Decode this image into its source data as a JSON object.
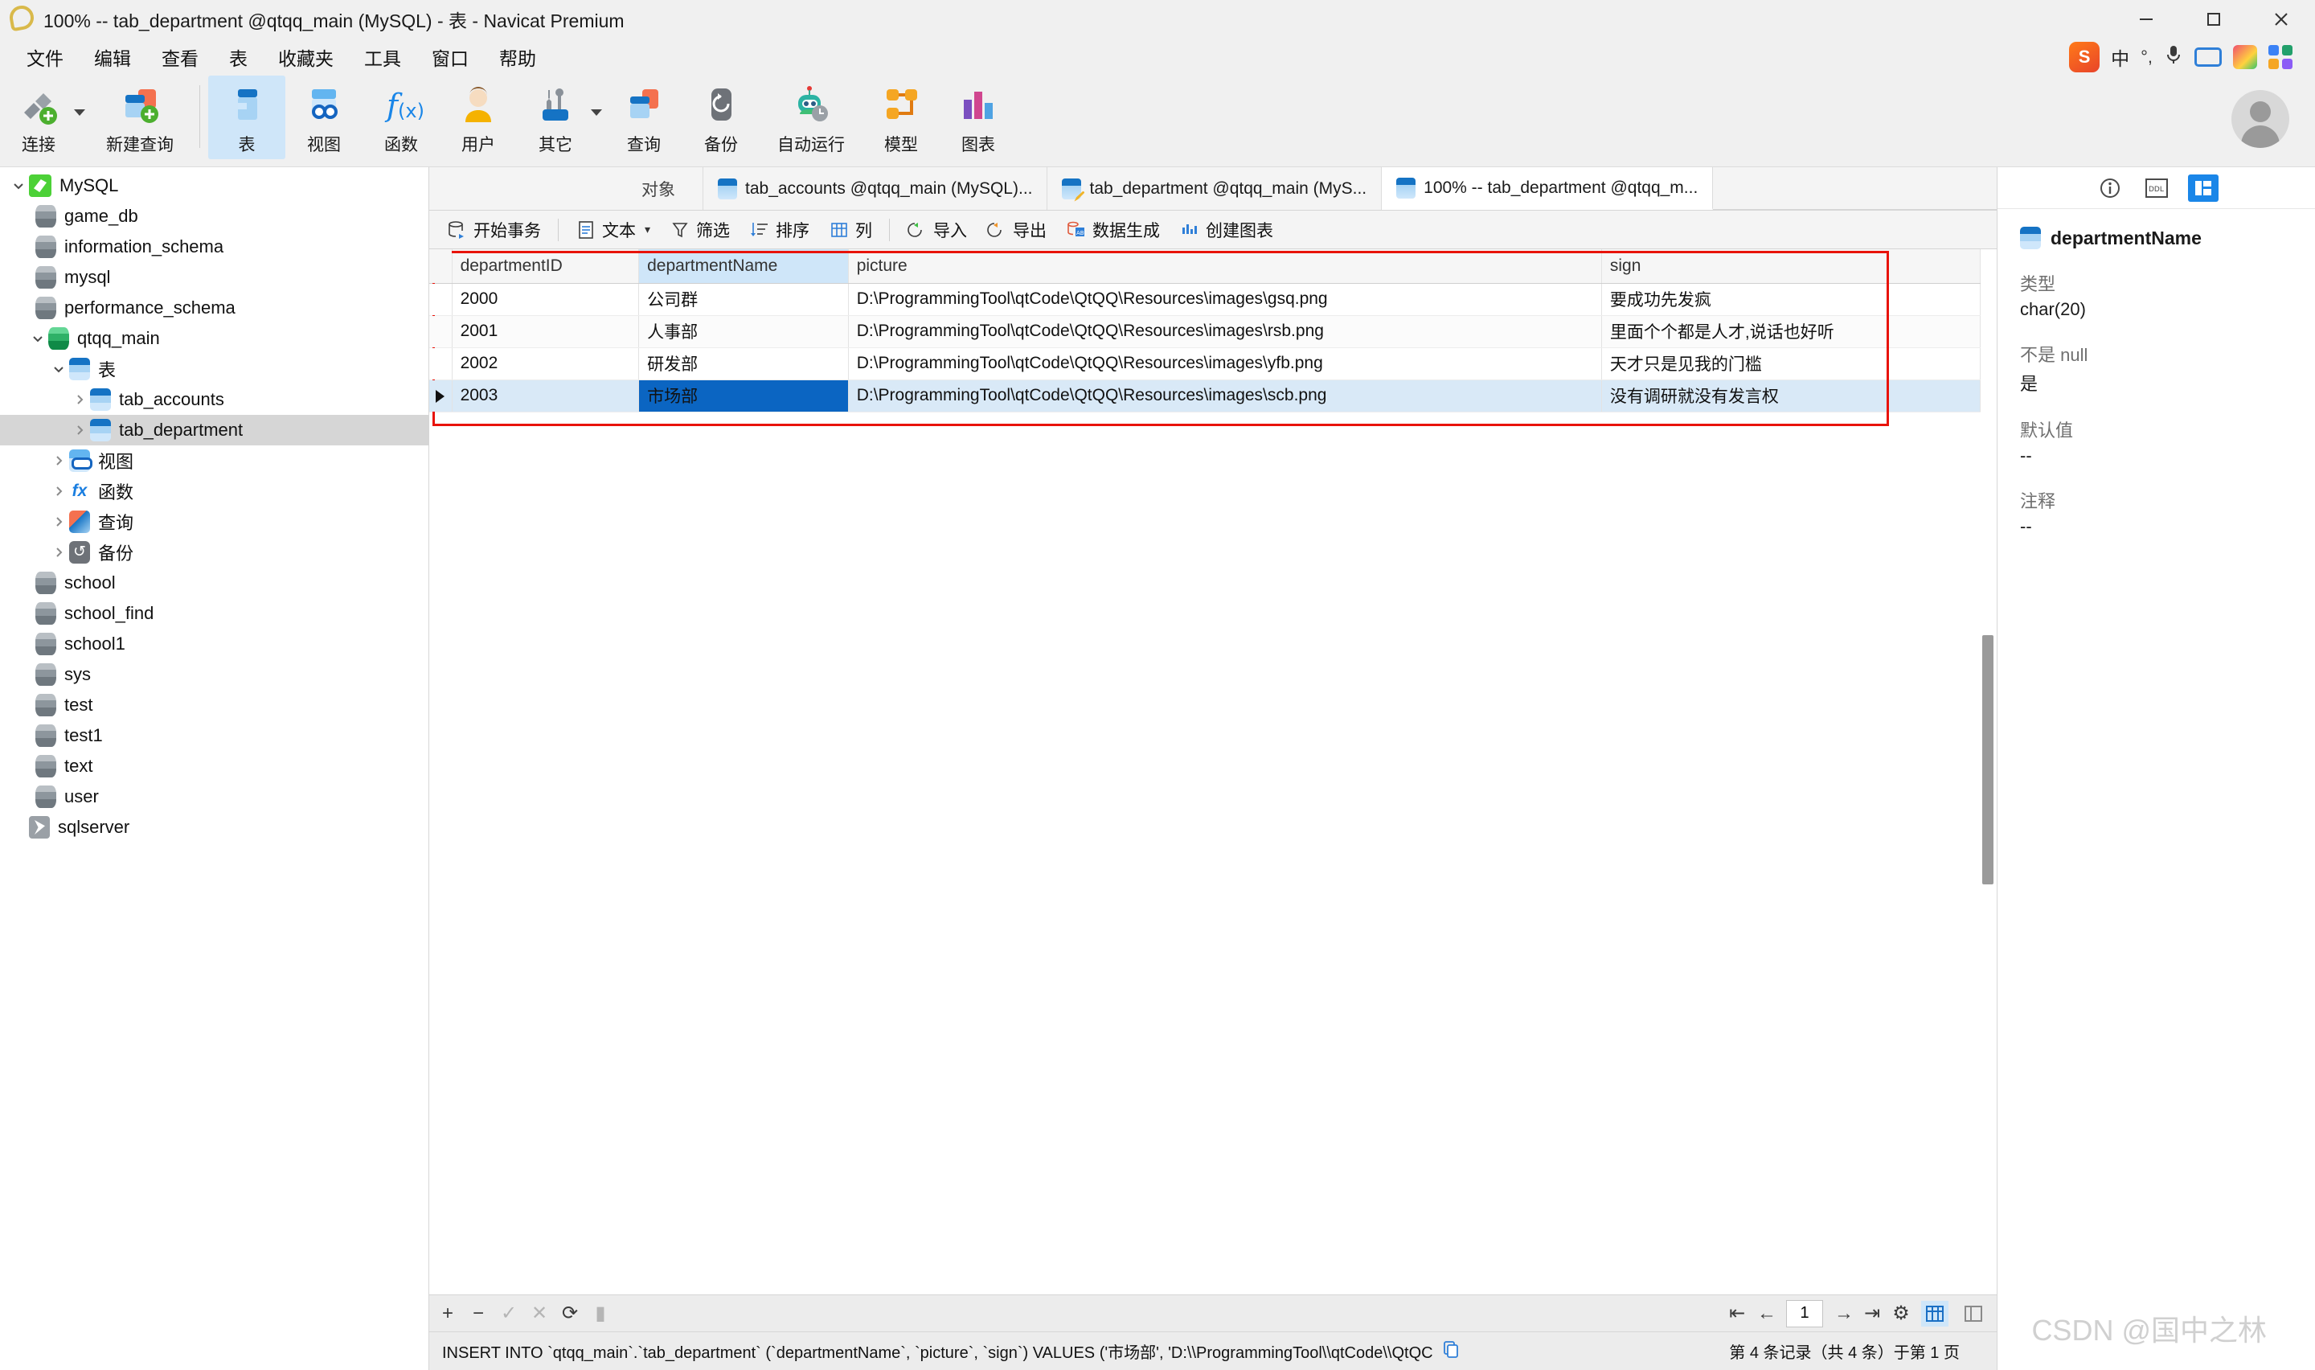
{
  "window": {
    "title": "100% -- tab_department @qtqq_main (MySQL) - 表 - Navicat Premium",
    "minimize_label": "—",
    "maximize_label": "▢",
    "close_label": "✕"
  },
  "menubar": {
    "items": [
      {
        "label": "文件"
      },
      {
        "label": "编辑"
      },
      {
        "label": "查看"
      },
      {
        "label": "表"
      },
      {
        "label": "收藏夹"
      },
      {
        "label": "工具"
      },
      {
        "label": "窗口"
      },
      {
        "label": "帮助"
      }
    ],
    "ime": {
      "logo": "S",
      "mode": "中",
      "punct": "°,",
      "mic_icon": "microphone-icon",
      "keyboard_icon": "keyboard-icon",
      "pen_icon": "handwriting-icon",
      "apps_icon": "apps-grid-icon"
    }
  },
  "toolbar": {
    "buttons": [
      {
        "label": "连接",
        "icon": "new-connection-icon",
        "dropdown": true,
        "active": false
      },
      {
        "label": "新建查询",
        "icon": "new-query-icon",
        "dropdown": false,
        "active": false
      },
      {
        "label": "表",
        "icon": "table-icon",
        "dropdown": false,
        "active": true
      },
      {
        "label": "视图",
        "icon": "view-icon",
        "dropdown": false,
        "active": false
      },
      {
        "label": "函数",
        "icon": "function-icon",
        "dropdown": false,
        "active": false
      },
      {
        "label": "用户",
        "icon": "user-icon",
        "dropdown": false,
        "active": false
      },
      {
        "label": "其它",
        "icon": "other-tools-icon",
        "dropdown": true,
        "active": false
      },
      {
        "label": "查询",
        "icon": "query-icon",
        "dropdown": false,
        "active": false
      },
      {
        "label": "备份",
        "icon": "backup-icon",
        "dropdown": false,
        "active": false
      },
      {
        "label": "自动运行",
        "icon": "automation-robot-icon",
        "dropdown": false,
        "active": false
      },
      {
        "label": "模型",
        "icon": "model-icon",
        "dropdown": false,
        "active": false
      },
      {
        "label": "图表",
        "icon": "chart-icon",
        "dropdown": false,
        "active": false
      }
    ]
  },
  "sidebar": {
    "nodes": [
      {
        "label": "MySQL",
        "icon": "mysql-icon",
        "level": 1,
        "chevron": "down",
        "selected": false
      },
      {
        "label": "game_db",
        "icon": "database-icon",
        "level": 2,
        "chevron": "",
        "selected": false
      },
      {
        "label": "information_schema",
        "icon": "database-icon",
        "level": 2,
        "chevron": "",
        "selected": false
      },
      {
        "label": "mysql",
        "icon": "database-icon",
        "level": 2,
        "chevron": "",
        "selected": false
      },
      {
        "label": "performance_schema",
        "icon": "database-icon",
        "level": 2,
        "chevron": "",
        "selected": false
      },
      {
        "label": "qtqq_main",
        "icon": "database-green-icon",
        "level": 1,
        "chevron": "down",
        "selected": false
      },
      {
        "label": "表",
        "icon": "table-icon",
        "level": 3,
        "chevron": "down",
        "selected": false
      },
      {
        "label": "tab_accounts",
        "icon": "table-icon",
        "level": 4,
        "chevron": "right",
        "selected": false
      },
      {
        "label": "tab_department",
        "icon": "table-icon",
        "level": 4,
        "chevron": "right",
        "selected": true
      },
      {
        "label": "视图",
        "icon": "view-icon",
        "level": 3,
        "chevron": "right",
        "selected": false
      },
      {
        "label": "函数",
        "icon": "function-icon",
        "level": 3,
        "chevron": "right",
        "selected": false
      },
      {
        "label": "查询",
        "icon": "query-icon",
        "level": 3,
        "chevron": "right",
        "selected": false
      },
      {
        "label": "备份",
        "icon": "backup-icon",
        "level": 3,
        "chevron": "right",
        "selected": false
      },
      {
        "label": "school",
        "icon": "database-icon",
        "level": 2,
        "chevron": "",
        "selected": false
      },
      {
        "label": "school_find",
        "icon": "database-icon",
        "level": 2,
        "chevron": "",
        "selected": false
      },
      {
        "label": "school1",
        "icon": "database-icon",
        "level": 2,
        "chevron": "",
        "selected": false
      },
      {
        "label": "sys",
        "icon": "database-icon",
        "level": 2,
        "chevron": "",
        "selected": false
      },
      {
        "label": "test",
        "icon": "database-icon",
        "level": 2,
        "chevron": "",
        "selected": false
      },
      {
        "label": "test1",
        "icon": "database-icon",
        "level": 2,
        "chevron": "",
        "selected": false
      },
      {
        "label": "text",
        "icon": "database-icon",
        "level": 2,
        "chevron": "",
        "selected": false
      },
      {
        "label": "user",
        "icon": "database-icon",
        "level": 2,
        "chevron": "",
        "selected": false
      },
      {
        "label": "sqlserver",
        "icon": "sqlserver-icon",
        "level": 1,
        "chevron": "",
        "selected": false
      }
    ]
  },
  "tabs": [
    {
      "label": "对象",
      "icon": "",
      "active": false,
      "plain": true
    },
    {
      "label": "tab_accounts @qtqq_main (MySQL)...",
      "icon": "table-icon",
      "active": false,
      "plain": false
    },
    {
      "label": "tab_department @qtqq_main (MyS...",
      "icon": "table-edit-icon",
      "active": false,
      "plain": false
    },
    {
      "label": "100% -- tab_department @qtqq_m...",
      "icon": "table-icon",
      "active": true,
      "plain": false
    }
  ],
  "gridtools": {
    "groups": [
      [
        {
          "label": "开始事务",
          "icon": "transaction-icon",
          "dropdown": false
        }
      ],
      [
        {
          "label": "文本",
          "icon": "text-icon",
          "dropdown": true
        },
        {
          "label": "筛选",
          "icon": "filter-icon",
          "dropdown": false
        },
        {
          "label": "排序",
          "icon": "sort-icon",
          "dropdown": false
        },
        {
          "label": "列",
          "icon": "columns-icon",
          "dropdown": false
        }
      ],
      [
        {
          "label": "导入",
          "icon": "import-icon",
          "dropdown": false
        },
        {
          "label": "导出",
          "icon": "export-icon",
          "dropdown": false
        },
        {
          "label": "数据生成",
          "icon": "data-generation-icon",
          "dropdown": false
        },
        {
          "label": "创建图表",
          "icon": "create-chart-icon",
          "dropdown": false
        }
      ]
    ]
  },
  "grid": {
    "columns": [
      "departmentID",
      "departmentName",
      "picture",
      "sign"
    ],
    "selected_column_index": 1,
    "selected_row_index": 3,
    "selected_cell": {
      "row": 3,
      "column": 1
    },
    "rows": [
      {
        "departmentID": "2000",
        "departmentName": "公司群",
        "picture": "D:\\ProgrammingTool\\qtCode\\QtQQ\\Resources\\images\\gsq.png",
        "sign": "要成功先发疯"
      },
      {
        "departmentID": "2001",
        "departmentName": "人事部",
        "picture": "D:\\ProgrammingTool\\qtCode\\QtQQ\\Resources\\images\\rsb.png",
        "sign": "里面个个都是人才,说话也好听"
      },
      {
        "departmentID": "2002",
        "departmentName": "研发部",
        "picture": "D:\\ProgrammingTool\\qtCode\\QtQQ\\Resources\\images\\yfb.png",
        "sign": "天才只是见我的门槛"
      },
      {
        "departmentID": "2003",
        "departmentName": "市场部",
        "picture": "D:\\ProgrammingTool\\qtCode\\QtQQ\\Resources\\images\\scb.png",
        "sign": "没有调研就没有发言权"
      }
    ]
  },
  "navbar": {
    "record_buttons": [
      {
        "icon": "add-record-icon",
        "label": "+",
        "enabled": true
      },
      {
        "icon": "remove-record-icon",
        "label": "−",
        "enabled": true
      },
      {
        "icon": "apply-change-icon",
        "label": "✓",
        "enabled": false
      },
      {
        "icon": "cancel-change-icon",
        "label": "✕",
        "enabled": false
      },
      {
        "icon": "refresh-icon",
        "label": "⟳",
        "enabled": true
      },
      {
        "icon": "stop-icon",
        "label": "▮",
        "enabled": false
      }
    ],
    "pager": {
      "first_icon": "first-page-icon",
      "prev_icon": "prev-page-icon",
      "page_value": "1",
      "next_icon": "next-page-icon",
      "last_icon": "last-page-icon",
      "settings_icon": "gear-icon"
    },
    "view_toggles": [
      {
        "icon": "grid-view-icon",
        "active": true
      },
      {
        "icon": "form-view-icon",
        "active": false
      }
    ]
  },
  "statusbar": {
    "sql": "INSERT INTO `qtqq_main`.`tab_department` (`departmentName`, `picture`, `sign`) VALUES ('市场部', 'D:\\\\ProgrammingTool\\\\qtCode\\\\QtQC",
    "copy_icon": "copy-icon",
    "record_info": "第 4 条记录（共 4 条）于第 1 页"
  },
  "rightpanel": {
    "tabs": [
      {
        "icon": "info-icon",
        "label": "i",
        "active": false
      },
      {
        "icon": "ddl-icon",
        "label": "DDL",
        "active": false
      },
      {
        "icon": "field-detail-icon",
        "label": "",
        "active": true
      }
    ],
    "field_name": "departmentName",
    "fields": [
      {
        "label": "类型",
        "value": "char(20)"
      },
      {
        "label": "不是 null",
        "value": "是"
      },
      {
        "label": "默认值",
        "value": "--"
      },
      {
        "label": "注释",
        "value": "--"
      }
    ]
  },
  "watermark": {
    "text": "CSDN @国中之林"
  }
}
